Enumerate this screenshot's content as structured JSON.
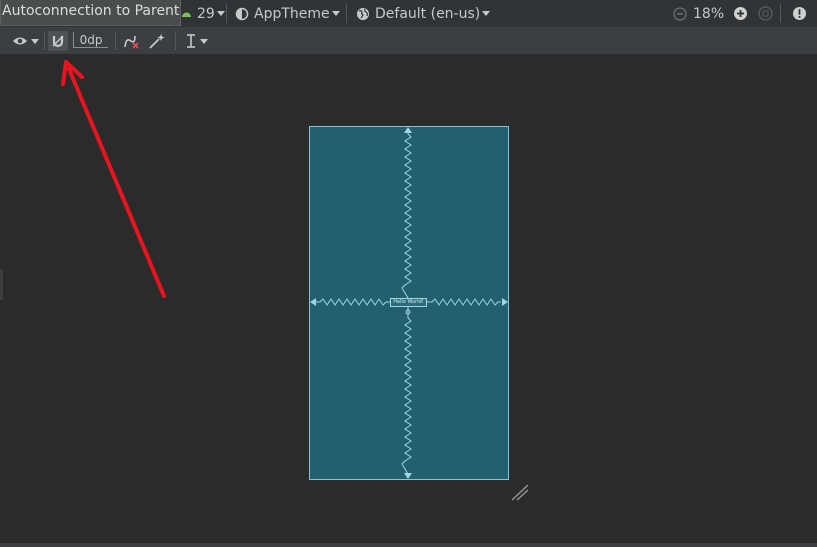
{
  "tooltip": {
    "text": "Autoconnection to Parent"
  },
  "top_toolbar": {
    "api_level": "29",
    "theme": "AppTheme",
    "locale": "Default (en-us)",
    "zoom": "18%"
  },
  "design_toolbar": {
    "margin_value": "0dp"
  },
  "canvas": {
    "widget_text": "Hello World!"
  },
  "colors": {
    "accent_arrow": "#e8141e",
    "blueprint_fill": "#245f6e",
    "blueprint_line": "#7fc6d6"
  },
  "icons": [
    "android-icon",
    "theme-icon",
    "globe-icon",
    "zoom-out-icon",
    "zoom-in-icon",
    "zoom-fit-icon",
    "warning-icon",
    "eye-icon",
    "magnet-icon",
    "clear-constraints-icon",
    "infer-constraints-icon",
    "guidelines-icon",
    "resize-handle-icon"
  ]
}
